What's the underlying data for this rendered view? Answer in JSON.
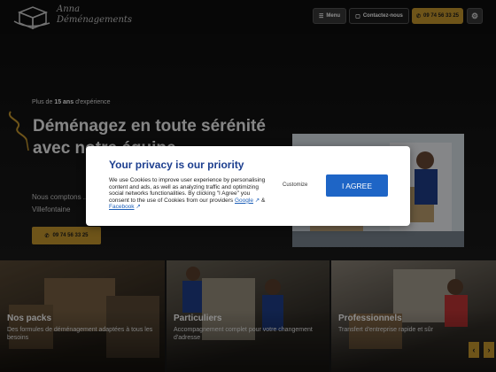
{
  "header": {
    "logo_line1": "Anna",
    "logo_line2": "Déménagements",
    "menu_label": "Menu",
    "contact_label": "Contactez-nous",
    "phone_label": "09 74 56 33 25",
    "settings_icon": "gear-icon"
  },
  "hero": {
    "experience_prefix": "Plus de",
    "experience_bold": "15 ans",
    "experience_suffix": "d'expérience",
    "title": "Déménagez en toute sérénité avec notre équipe",
    "subtitle": "Nous comptons ... à Villefontaine",
    "phone_label": "09 74 56 33 25"
  },
  "cards": [
    {
      "title": "Nos packs",
      "description": "Des formules de déménagement adaptées à tous les besoins"
    },
    {
      "title": "Particuliers",
      "description": "Accompagnement complet pour votre changement d'adresse"
    },
    {
      "title": "Professionnels",
      "description": "Transfert d'entreprise rapide et sûr"
    }
  ],
  "carousel": {
    "prev_icon": "chevron-left-icon",
    "next_icon": "chevron-right-icon"
  },
  "consent": {
    "title": "Your privacy is our priority",
    "body_before": "We use Cookies to improve user experience by personalising content and ads, as well as analyzing traffic and optimizing social networks functionalities. By clicking \"I Agree\" you consent to the use of Cookies from our providers",
    "google_link": "Google",
    "amp": "&",
    "facebook_link": "Facebook",
    "customize_label": "Customize",
    "agree_label": "I AGREE"
  },
  "colors": {
    "accent_gold": "#c99a2e",
    "consent_blue": "#1e65c6",
    "title_blue": "#1d3f8f"
  }
}
